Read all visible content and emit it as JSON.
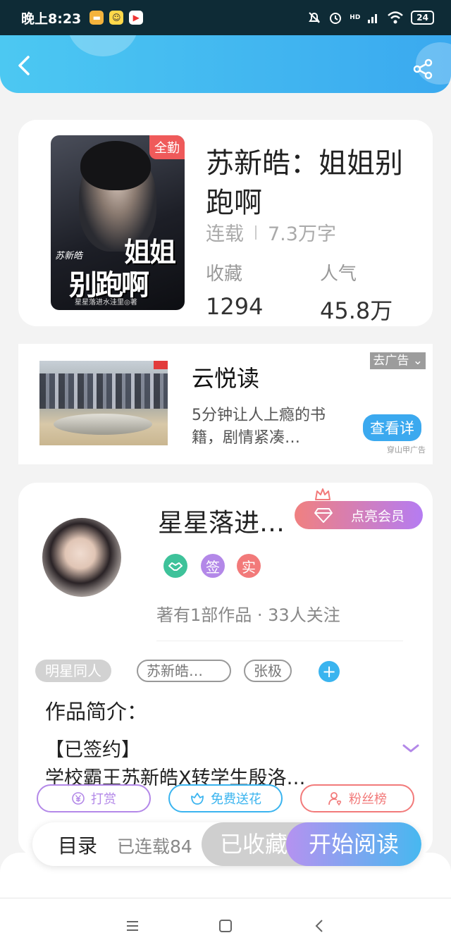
{
  "status_bar": {
    "time": "晚上8:23",
    "battery": "24",
    "network": "HD",
    "icons": [
      "mute-bell-icon",
      "alarm-icon",
      "signal-icon",
      "wifi-icon",
      "battery-icon"
    ]
  },
  "header": {
    "back_icon": "back-arrow-icon",
    "share_icon": "share-icon"
  },
  "book": {
    "cover": {
      "tag": "全勤",
      "title_small": "苏新皓",
      "title_line1": "姐姐",
      "title_line2": "别跑啊",
      "author_line": "星星落进水洼里◎著"
    },
    "title": "苏新皓：姐姐别跑啊",
    "status": "连载",
    "word_count": "7.3万字",
    "favorites_label": "收藏",
    "favorites_value": "1294",
    "popularity_label": "人气",
    "popularity_value": "45.8万"
  },
  "ad": {
    "close_label": "去广告",
    "title": "云悦读",
    "description": "5分钟让人上瘾的书籍，剧情紧凑…",
    "button_label": "查看详",
    "source": "穿山甲广告"
  },
  "author": {
    "name": "星星落进…",
    "vip_label": "点亮会员",
    "badges": [
      {
        "label": "",
        "color": "#3ec29a",
        "icon": "handshake-icon"
      },
      {
        "label": "签",
        "color": "#b388e8"
      },
      {
        "label": "实",
        "color": "#f27a7a"
      }
    ],
    "stats": "著有1部作品 · 33人关注"
  },
  "tags": {
    "category": "明星同人",
    "items": [
      "苏新皓…",
      "张极"
    ],
    "add_label": "+"
  },
  "intro": {
    "title": "作品简介：",
    "line1": "【已签约】",
    "line2": "学校霸王苏新皓X转学生殷洛…"
  },
  "actions": [
    {
      "label": "打赏",
      "color": "#b388e8",
      "icon": "yen-icon"
    },
    {
      "label": "免费送花",
      "color": "#3ab4ef",
      "icon": "flower-icon"
    },
    {
      "label": "粉丝榜",
      "color": "#f27a7a",
      "icon": "fan-user-icon"
    }
  ],
  "bottom_bar": {
    "catalog_label": "目录",
    "progress": "已连载84",
    "collected_label": "已收藏",
    "read_label": "开始阅读"
  },
  "navbar": {
    "icons": [
      "menu-icon",
      "home-square-icon",
      "back-triangle-icon"
    ]
  }
}
